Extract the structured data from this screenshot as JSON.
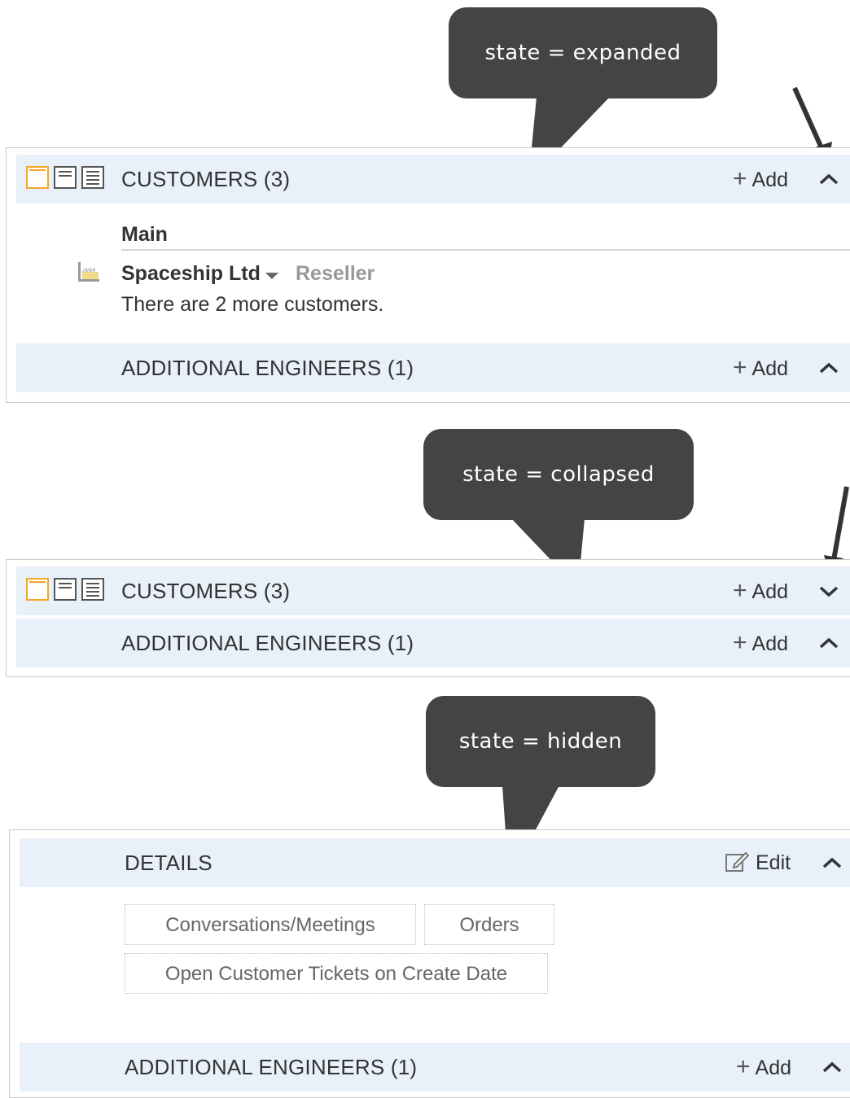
{
  "callouts": {
    "expanded": "state = expanded",
    "collapsed": "state = collapsed",
    "hidden": "state = hidden"
  },
  "panel_expanded": {
    "customers_header": {
      "title": "CUSTOMERS (3)",
      "add_label": "Add",
      "toggle_icon": "chevron-up-icon"
    },
    "subsection_label": "Main",
    "customer": {
      "name": "Spaceship Ltd",
      "role": "Reseller",
      "icon": "factory-icon"
    },
    "more_text": "There are 2 more customers.",
    "engineers_header": {
      "title": "ADDITIONAL ENGINEERS (1)",
      "add_label": "Add",
      "toggle_icon": "chevron-up-icon"
    }
  },
  "panel_collapsed": {
    "customers_header": {
      "title": "CUSTOMERS (3)",
      "add_label": "Add",
      "toggle_icon": "chevron-down-icon"
    },
    "engineers_header": {
      "title": "ADDITIONAL ENGINEERS (1)",
      "add_label": "Add",
      "toggle_icon": "chevron-up-icon"
    }
  },
  "panel_hidden": {
    "details_header": {
      "title": "DETAILS",
      "edit_label": "Edit",
      "toggle_icon": "chevron-up-icon"
    },
    "tabs": [
      "Conversations/Meetings",
      "Orders",
      "Open Customer Tickets on Create Date"
    ],
    "engineers_header": {
      "title": "ADDITIONAL ENGINEERS (1)",
      "add_label": "Add",
      "toggle_icon": "chevron-up-icon"
    }
  },
  "colors": {
    "header_bg": "#e8f0f9",
    "callout_bg": "#444444",
    "active_layout_icon": "#f5a623"
  }
}
